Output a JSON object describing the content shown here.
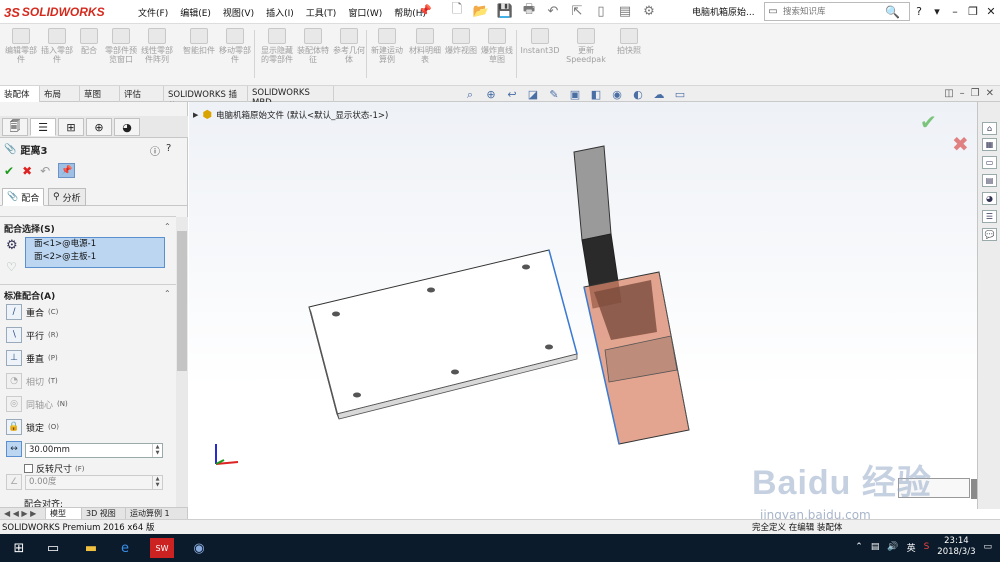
{
  "app": {
    "logo_text": "SOLIDWORKS",
    "logo_mark": "3S"
  },
  "menu": [
    "文件(F)",
    "编辑(E)",
    "视图(V)",
    "插入(I)",
    "工具(T)",
    "窗口(W)",
    "帮助(H)"
  ],
  "document_title": "电脑机箱原始...",
  "search": {
    "placeholder": "搜索知识库"
  },
  "command_manager": [
    {
      "label": "编辑零部件"
    },
    {
      "label": "插入零部件"
    },
    {
      "label": "配合"
    },
    {
      "label": "零部件预览窗口"
    },
    {
      "label": "线性零部件阵列"
    },
    {
      "label": "智能扣件"
    },
    {
      "label": "移动零部件"
    },
    {
      "label": "显示隐藏的零部件"
    },
    {
      "label": "装配体特征"
    },
    {
      "label": "参考几何体"
    },
    {
      "label": "新建运动算例"
    },
    {
      "label": "材料明细表"
    },
    {
      "label": "爆炸视图"
    },
    {
      "label": "爆炸直线草图"
    },
    {
      "label": "Instant3D"
    },
    {
      "label": "更新Speedpak"
    },
    {
      "label": "拍快照"
    }
  ],
  "command_tabs": [
    "装配体",
    "布局",
    "草图",
    "评估",
    "SOLIDWORKS 插件",
    "SOLIDWORKS MBD"
  ],
  "property_manager": {
    "title": "距离3",
    "subtabs": [
      "配合",
      "分析"
    ],
    "selection_group": "配合选择(S)",
    "selections": [
      "面<1>@电源-1",
      "面<2>@主板-1"
    ],
    "standard_group": "标准配合(A)",
    "mates": [
      {
        "label": "重合",
        "suffix": "(C)",
        "enabled": true,
        "icon": "coincident-icon"
      },
      {
        "label": "平行",
        "suffix": "(R)",
        "enabled": true,
        "icon": "parallel-icon"
      },
      {
        "label": "垂直",
        "suffix": "(P)",
        "enabled": true,
        "icon": "perpendicular-icon"
      },
      {
        "label": "相切",
        "suffix": "(T)",
        "enabled": false,
        "icon": "tangent-icon"
      },
      {
        "label": "同轴心",
        "suffix": "(N)",
        "enabled": false,
        "icon": "concentric-icon"
      },
      {
        "label": "锁定",
        "suffix": "(O)",
        "enabled": true,
        "icon": "lock-icon"
      }
    ],
    "distance_value": "30.00mm",
    "flip_label": "反转尺寸",
    "flip_suffix": "(F)",
    "angle_value": "0.00度",
    "alignment_label": "配合对齐:"
  },
  "bottom_tabs": [
    "模型",
    "3D 视图",
    "运动算例 1"
  ],
  "tree_flyout": "电脑机箱原始文件 (默认<默认_显示状态-1>)",
  "status_left": "SOLIDWORKS Premium 2016 x64 版",
  "status_right": "完全定义  在编辑 装配体",
  "watermark": "Baidu 经验",
  "watermark_sub": "jingyan.baidu.com",
  "taskbar": {
    "time": "23:14",
    "date": "2018/3/3",
    "ime": "英"
  },
  "colors": {
    "brand": "#d52b1e",
    "accent": "#2b6cb0",
    "selection": "#bcd6f2"
  }
}
